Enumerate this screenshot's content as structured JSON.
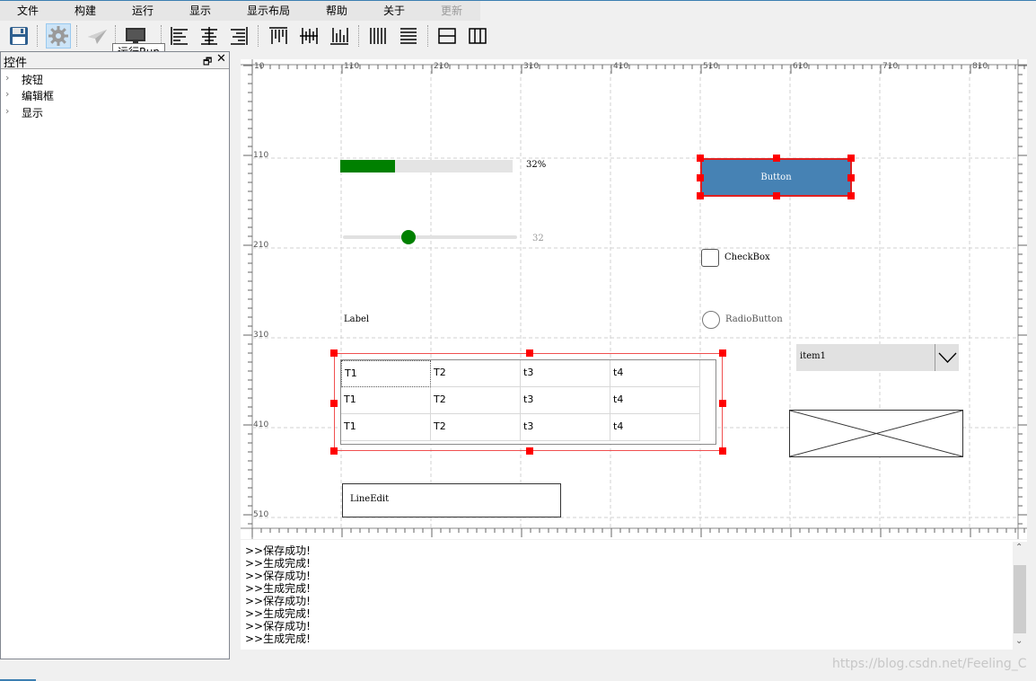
{
  "menu": [
    {
      "label": "文件",
      "disabled": false
    },
    {
      "label": "构建",
      "disabled": false
    },
    {
      "label": "运行",
      "disabled": false
    },
    {
      "label": "显示",
      "disabled": false
    },
    {
      "label": "显示布局",
      "disabled": false
    },
    {
      "label": "帮助",
      "disabled": false
    },
    {
      "label": "关于",
      "disabled": false
    },
    {
      "label": "更新",
      "disabled": true
    }
  ],
  "toolbar": {
    "buttons": [
      "save-icon",
      "settings-icon",
      "send-icon",
      "monitor-icon",
      "align-left-icon",
      "align-center-icon",
      "align-right-icon",
      "align-top-icon",
      "align-middle-icon",
      "align-bottom-icon",
      "distribute-horizontal-icon",
      "distribute-vertical-icon",
      "layout-rows-icon",
      "layout-columns-icon"
    ],
    "tooltip": "运行Run"
  },
  "dock": {
    "title": "控件",
    "items": [
      "按钮",
      "编辑框",
      "显示"
    ]
  },
  "canvas": {
    "ruler_top_labels": [
      "10",
      "110",
      "210",
      "310",
      "410",
      "510",
      "610",
      "710",
      "810"
    ],
    "ruler_left_labels": [
      "110",
      "210",
      "310",
      "410",
      "510"
    ],
    "progress": {
      "value": 32,
      "text": "32%"
    },
    "slider": {
      "value": 32,
      "text": "32"
    },
    "label": "Label",
    "table": {
      "rows": [
        [
          "T1",
          "T2",
          "t3",
          "t4"
        ],
        [
          "T1",
          "T2",
          "t3",
          "t4"
        ],
        [
          "T1",
          "T2",
          "t3",
          "t4"
        ]
      ]
    },
    "lineedit": "LineEdit",
    "button": "Button",
    "checkbox": "CheckBox",
    "radio": "RadioButton",
    "combo": "item1"
  },
  "console": {
    "lines": [
      ">>保存成功!",
      ">>生成完成!",
      ">>保存成功!",
      ">>生成完成!",
      ">>保存成功!",
      ">>生成完成!",
      ">>保存成功!",
      ">>生成完成!"
    ]
  },
  "colors": {
    "accent": "#3c7fb1",
    "progress_fill": "#008000",
    "button_bg": "#4682b4",
    "selection_handle": "#ff0000"
  },
  "watermark": "https://blog.csdn.net/Feeling_C"
}
